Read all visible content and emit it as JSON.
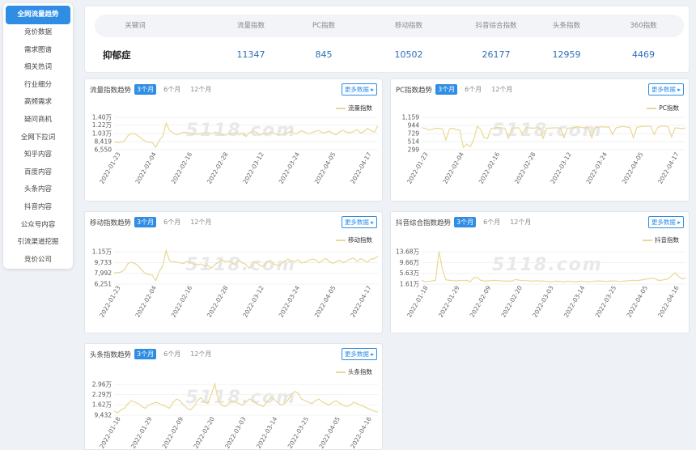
{
  "sidebar": {
    "items": [
      "全网流量趋势",
      "竞价数据",
      "需求图谱",
      "相关热词",
      "行业细分",
      "高频需求",
      "疑问商机",
      "全网下拉词",
      "知乎内容",
      "百度内容",
      "头条内容",
      "抖音内容",
      "公众号内容",
      "引流渠道挖掘",
      "竞价公司"
    ],
    "active_index": 0
  },
  "keyword_table": {
    "headers": [
      "关键词",
      "流量指数",
      "PC指数",
      "移动指数",
      "抖音综合指数",
      "头条指数",
      "360指数"
    ],
    "row": [
      "抑郁症",
      "11347",
      "845",
      "10502",
      "26177",
      "12959",
      "4469"
    ]
  },
  "periods": [
    "3个月",
    "6个月",
    "12个月"
  ],
  "more_label": "更多数据",
  "watermark": "5118.com",
  "charts": [
    {
      "title": "流量指数趋势",
      "legend": "流量指数",
      "yticks": [
        "1.40万",
        "1.22万",
        "1.03万",
        "8,419",
        "6,550"
      ],
      "xticks": [
        "2022-01-23",
        "2022-02-04",
        "2022-02-16",
        "2022-02-28",
        "2022-03-12",
        "2022-03-24",
        "2022-04-05",
        "2022-04-17"
      ],
      "chart_data": {
        "type": "line",
        "series": [
          {
            "name": "流量指数",
            "values": [
              8419,
              8200,
              8300,
              8600,
              9800,
              10300,
              10200,
              9700,
              9000,
              8500,
              8300,
              8200,
              7100,
              8700,
              9600,
              12700,
              11000,
              10400,
              10000,
              10300,
              10600,
              10500,
              10400,
              10200,
              10100,
              10300,
              10400,
              10500,
              10200,
              10600,
              10400,
              10000,
              9900,
              10200,
              10300,
              10500,
              10000,
              10400,
              9600,
              10500,
              10700,
              10600,
              9900,
              10200,
              10300,
              10600,
              10300,
              10100,
              9900,
              10200,
              10500,
              10800,
              10200,
              10400,
              10900,
              10600,
              10200,
              10500,
              10800,
              11000,
              10400,
              10600,
              10800,
              10300,
              10000,
              10700,
              11000,
              10600,
              10500,
              10700,
              11200,
              10400,
              10700,
              11500,
              10900,
              10600,
              12100
            ]
          }
        ]
      }
    },
    {
      "title": "PC指数趋势",
      "legend": "PC指数",
      "yticks": [
        "1,159",
        "944",
        "729",
        "514",
        "299"
      ],
      "xticks": [
        "2022-01-23",
        "2022-02-04",
        "2022-02-16",
        "2022-02-28",
        "2022-03-12",
        "2022-03-24",
        "2022-04-05",
        "2022-04-17"
      ],
      "chart_data": {
        "type": "line",
        "series": [
          {
            "name": "PC指数",
            "values": [
              880,
              870,
              820,
              840,
              870,
              860,
              850,
              560,
              850,
              870,
              830,
              820,
              360,
              450,
              380,
              560,
              920,
              840,
              620,
              600,
              860,
              880,
              890,
              880,
              870,
              600,
              870,
              880,
              880,
              720,
              880,
              880,
              870,
              880,
              880,
              600,
              870,
              870,
              880,
              880,
              880,
              620,
              870,
              880,
              880,
              910,
              890,
              880,
              890,
              620,
              880,
              900,
              910,
              900,
              900,
              700,
              880,
              900,
              920,
              900,
              890,
              620,
              890,
              910,
              920,
              930,
              920,
              700,
              890,
              920,
              930,
              900,
              640,
              880,
              870,
              860,
              880
            ]
          }
        ]
      }
    },
    {
      "title": "移动指数趋势",
      "legend": "移动指数",
      "yticks": [
        "1.15万",
        "9,733",
        "7,992",
        "6,251"
      ],
      "xticks": [
        "2022-01-23",
        "2022-02-04",
        "2022-02-16",
        "2022-02-28",
        "2022-03-12",
        "2022-03-24",
        "2022-04-05",
        "2022-04-17"
      ],
      "chart_data": {
        "type": "line",
        "series": [
          {
            "name": "移动指数",
            "values": [
              8100,
              8100,
              8200,
              8600,
              9600,
              9800,
              9600,
              9200,
              8500,
              8000,
              7800,
              7700,
              6800,
              8300,
              9200,
              11700,
              10000,
              9900,
              9800,
              9700,
              9600,
              9900,
              9800,
              9500,
              9400,
              9500,
              9200,
              9300,
              8800,
              9400,
              9800,
              10200,
              9900,
              10000,
              9600,
              9400,
              10100,
              9700,
              9400,
              8800,
              9900,
              9700,
              9300,
              9100,
              9800,
              10100,
              9500,
              9300,
              9400,
              9900,
              10300,
              10000,
              9900,
              10200,
              9700,
              9800,
              10100,
              10300,
              10200,
              9700,
              10100,
              10400,
              9900,
              9600,
              9900,
              10100,
              9700,
              10000,
              10300,
              10500,
              9900,
              10400,
              10100,
              9800,
              10300,
              10400,
              10800
            ]
          }
        ]
      }
    },
    {
      "title": "抖音综合指数趋势",
      "legend": "抖音指数",
      "yticks": [
        "13.68万",
        "9.66万",
        "5.63万",
        "1.61万"
      ],
      "xticks": [
        "2022-01-18",
        "2022-01-29",
        "2022-02-09",
        "2022-02-20",
        "2022-03-03",
        "2022-03-14",
        "2022-03-25",
        "2022-04-05",
        "2022-04-16"
      ],
      "chart_data": {
        "type": "line",
        "series": [
          {
            "name": "抖音指数",
            "values": [
              30000,
              25000,
              26000,
              28000,
              30000,
              138000,
              70000,
              32000,
              30000,
              29000,
              28000,
              30000,
              29000,
              30000,
              25000,
              40000,
              42000,
              30000,
              28000,
              28000,
              29000,
              30000,
              29000,
              28000,
              27000,
              28000,
              27000,
              33000,
              31000,
              29000,
              29000,
              28000,
              27000,
              29000,
              27000,
              28000,
              26000,
              24000,
              26000,
              27000,
              26000,
              25000,
              27000,
              26000,
              24000,
              25000,
              27000,
              26000,
              25000,
              26000,
              27000,
              28000,
              27000,
              26000,
              27000,
              28000,
              27000,
              26000,
              27000,
              28000,
              29000,
              30000,
              29000,
              31000,
              33000,
              35000,
              37000,
              38000,
              31000,
              30000,
              33000,
              35000,
              47000,
              58000,
              45000,
              35000,
              40000
            ]
          }
        ]
      }
    },
    {
      "title": "头条指数趋势",
      "legend": "头条指数",
      "yticks": [
        "2.96万",
        "2.29万",
        "1.62万",
        "9,432"
      ],
      "xticks": [
        "2022-01-18",
        "2022-01-29",
        "2022-02-09",
        "2022-02-20",
        "2022-03-03",
        "2022-03-14",
        "2022-03-25",
        "2022-04-05",
        "2022-04-16"
      ],
      "chart_data": {
        "type": "line",
        "series": [
          {
            "name": "头条指数",
            "values": [
              12000,
              11000,
              13000,
              14000,
              17000,
              19000,
              18000,
              17000,
              15000,
              14000,
              16000,
              17000,
              18000,
              17000,
              16000,
              15000,
              14000,
              18000,
              20000,
              19000,
              16000,
              14000,
              13000,
              15000,
              19000,
              21000,
              18000,
              17000,
              23000,
              30000,
              19000,
              16000,
              15000,
              17000,
              19000,
              18000,
              17000,
              16000,
              18000,
              20000,
              19000,
              17000,
              16000,
              15000,
              18000,
              21000,
              20000,
              18000,
              16000,
              17000,
              19000,
              23000,
              25000,
              24000,
              20000,
              19000,
              18000,
              17000,
              19000,
              20000,
              18000,
              17000,
              16000,
              18000,
              19000,
              17000,
              16000,
              15000,
              16000,
              18000,
              17000,
              16000,
              15000,
              14000,
              13000,
              12000,
              11500
            ]
          }
        ]
      }
    }
  ]
}
